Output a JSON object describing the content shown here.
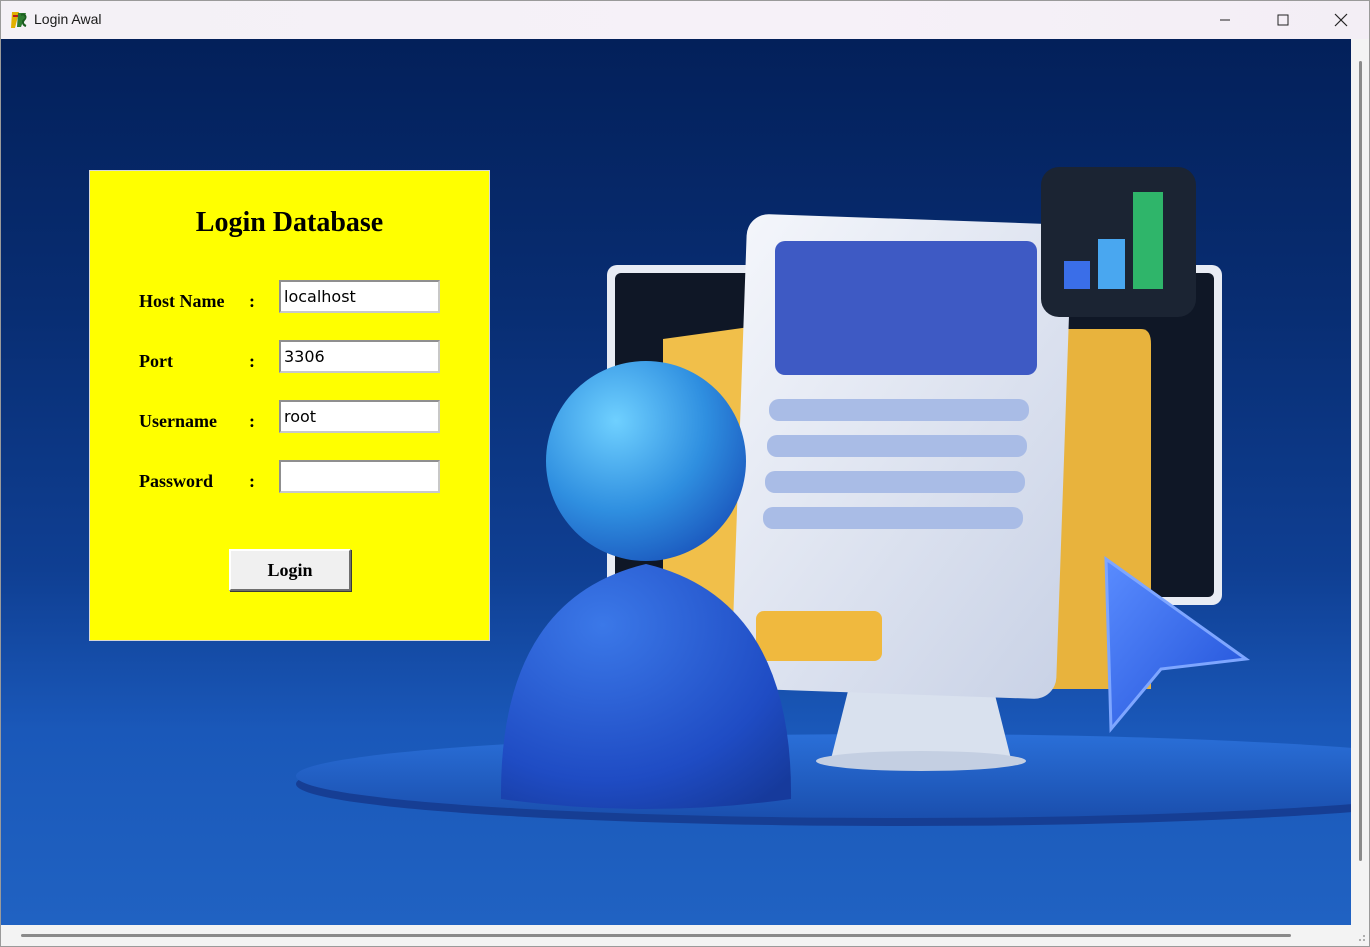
{
  "window": {
    "title": "Login Awal",
    "controls": {
      "minimize": "minimize-icon",
      "maximize": "maximize-icon",
      "close": "close-icon"
    }
  },
  "login": {
    "title": "Login Database",
    "fields": [
      {
        "label": "Host Name",
        "colon": ":",
        "value": "localhost"
      },
      {
        "label": "Port",
        "colon": ":",
        "value": "3306"
      },
      {
        "label": "Username",
        "colon": ":",
        "value": "root"
      },
      {
        "label": "Password",
        "colon": ":",
        "value": ""
      }
    ],
    "button_label": "Login"
  },
  "colors": {
    "panel": "#ffff00",
    "background_top": "#03205a",
    "background_bottom": "#2062c2"
  },
  "icons": {
    "app": "java-app-icon",
    "illustration": "user-with-database-monitor-illustration"
  }
}
